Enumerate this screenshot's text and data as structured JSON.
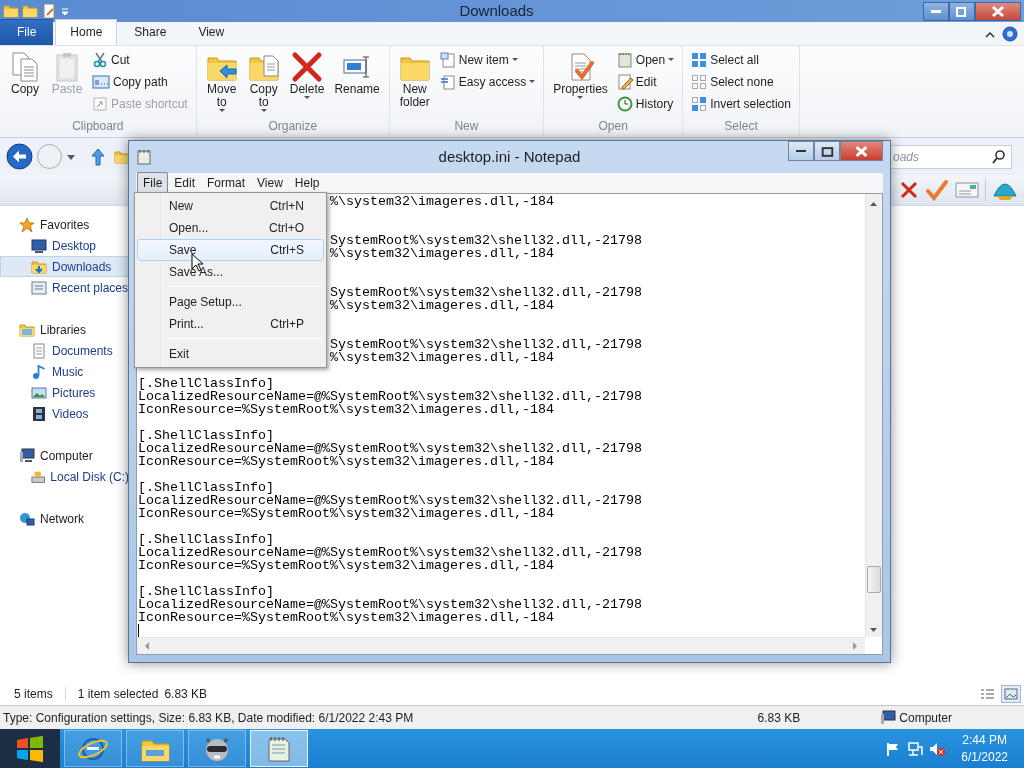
{
  "explorer": {
    "title": "Downloads",
    "ribbon_tabs": [
      {
        "label": "File",
        "kind": "file",
        "selected": false
      },
      {
        "label": "Home",
        "kind": "tab",
        "selected": true
      },
      {
        "label": "Share",
        "kind": "tab",
        "selected": false
      },
      {
        "label": "View",
        "kind": "tab",
        "selected": false
      }
    ],
    "ribbon_groups": [
      {
        "label": "Clipboard",
        "items": [
          {
            "label": "Copy",
            "kind": "large",
            "disabled": false,
            "dropdown": false
          },
          {
            "label": "Paste",
            "kind": "large",
            "disabled": true,
            "dropdown": false
          },
          {
            "label": "Cut",
            "kind": "small",
            "disabled": false,
            "dropdown": false
          },
          {
            "label": "Copy path",
            "kind": "small",
            "disabled": false,
            "dropdown": false
          },
          {
            "label": "Paste shortcut",
            "kind": "small",
            "disabled": true,
            "dropdown": false
          }
        ]
      },
      {
        "label": "Organize",
        "items": [
          {
            "label": "Move to",
            "kind": "large",
            "disabled": false,
            "dropdown": true
          },
          {
            "label": "Copy to",
            "kind": "large",
            "disabled": false,
            "dropdown": true
          },
          {
            "label": "Delete",
            "kind": "large",
            "disabled": false,
            "dropdown": true
          },
          {
            "label": "Rename",
            "kind": "large",
            "disabled": false,
            "dropdown": false
          }
        ]
      },
      {
        "label": "New",
        "items": [
          {
            "label": "New folder",
            "kind": "large",
            "disabled": false,
            "dropdown": false
          },
          {
            "label": "New item",
            "kind": "small",
            "disabled": false,
            "dropdown": true
          },
          {
            "label": "Easy access",
            "kind": "small",
            "disabled": false,
            "dropdown": true
          }
        ]
      },
      {
        "label": "Open",
        "items": [
          {
            "label": "Properties",
            "kind": "large",
            "disabled": false,
            "dropdown": true
          },
          {
            "label": "Open",
            "kind": "small",
            "disabled": false,
            "dropdown": true
          },
          {
            "label": "Edit",
            "kind": "small",
            "disabled": false,
            "dropdown": false
          },
          {
            "label": "History",
            "kind": "small",
            "disabled": false,
            "dropdown": false
          }
        ]
      },
      {
        "label": "Select",
        "items": [
          {
            "label": "Select all",
            "kind": "small",
            "disabled": false,
            "dropdown": false
          },
          {
            "label": "Select none",
            "kind": "small",
            "disabled": false,
            "dropdown": false
          },
          {
            "label": "Invert selection",
            "kind": "small",
            "disabled": false,
            "dropdown": false
          }
        ]
      }
    ],
    "search": {
      "placeholder": "oads"
    },
    "navigation": [
      {
        "label": "Favorites",
        "selected": false,
        "children": [
          {
            "label": "Desktop",
            "selected": false
          },
          {
            "label": "Downloads",
            "selected": true
          },
          {
            "label": "Recent places",
            "selected": false
          }
        ]
      },
      {
        "label": "Libraries",
        "selected": false,
        "children": [
          {
            "label": "Documents",
            "selected": false
          },
          {
            "label": "Music",
            "selected": false
          },
          {
            "label": "Pictures",
            "selected": false
          },
          {
            "label": "Videos",
            "selected": false
          }
        ]
      },
      {
        "label": "Computer",
        "selected": false,
        "children": [
          {
            "label": "Local Disk (C:)",
            "selected": false
          }
        ]
      },
      {
        "label": "Network",
        "selected": false
      }
    ],
    "status": {
      "item_count": "5 items",
      "selection": "1 item selected",
      "selection_size": "6.83 KB"
    },
    "view_buttons": [
      {
        "kind": "details",
        "selected": false
      },
      {
        "kind": "large_icons",
        "selected": true
      }
    ],
    "details_bar": {
      "description": "Type: Configuration settings, Size: 6.83 KB, Date modified: 6/1/2022 2:43 PM",
      "size": "6.83 KB",
      "location": "Computer"
    }
  },
  "notepad": {
    "title": "desktop.ini - Notepad",
    "menu": [
      {
        "label": "File",
        "selected": true
      },
      {
        "label": "Edit",
        "selected": false
      },
      {
        "label": "Format",
        "selected": false
      },
      {
        "label": "View",
        "selected": false
      },
      {
        "label": "Help",
        "selected": false
      }
    ],
    "file_menu": [
      {
        "kind": "item",
        "label": "New",
        "shortcut": "Ctrl+N",
        "selected": false
      },
      {
        "kind": "item",
        "label": "Open...",
        "shortcut": "Ctrl+O",
        "selected": false
      },
      {
        "kind": "item",
        "label": "Save",
        "shortcut": "Ctrl+S",
        "selected": true
      },
      {
        "kind": "item",
        "label": "Save As...",
        "selected": false
      },
      {
        "kind": "separator"
      },
      {
        "kind": "item",
        "label": "Page Setup...",
        "selected": false
      },
      {
        "kind": "item",
        "label": "Print...",
        "shortcut": "Ctrl+P",
        "selected": false
      },
      {
        "kind": "separator"
      },
      {
        "kind": "item",
        "label": "Exit",
        "selected": false
      }
    ],
    "lines": [
      {
        "kind": "partial",
        "text": "%\\system32\\imageres.dll,-184"
      },
      {
        "kind": "gap"
      },
      {
        "kind": "gap"
      },
      {
        "kind": "partial",
        "text": "SystemRoot%\\system32\\shell32.dll,-21798"
      },
      {
        "kind": "partial",
        "text": "%\\system32\\imageres.dll,-184"
      },
      {
        "kind": "gap"
      },
      {
        "kind": "gap"
      },
      {
        "kind": "partial",
        "text": "SystemRoot%\\system32\\shell32.dll,-21798"
      },
      {
        "kind": "partial",
        "text": "%\\system32\\imageres.dll,-184"
      },
      {
        "kind": "gap"
      },
      {
        "kind": "gap"
      },
      {
        "kind": "partial",
        "text": "SystemRoot%\\system32\\shell32.dll,-21798"
      },
      {
        "kind": "partial",
        "text": "%\\system32\\imageres.dll,-184"
      },
      {
        "kind": "gap"
      },
      {
        "kind": "full",
        "text": "[.ShellClassInfo]"
      },
      {
        "kind": "full",
        "text": "LocalizedResourceName=@%SystemRoot%\\system32\\shell32.dll,-21798"
      },
      {
        "kind": "full",
        "text": "IconResource=%SystemRoot%\\system32\\imageres.dll,-184"
      },
      {
        "kind": "gap"
      },
      {
        "kind": "full",
        "text": "[.ShellClassInfo]"
      },
      {
        "kind": "full",
        "text": "LocalizedResourceName=@%SystemRoot%\\system32\\shell32.dll,-21798"
      },
      {
        "kind": "full",
        "text": "IconResource=%SystemRoot%\\system32\\imageres.dll,-184"
      },
      {
        "kind": "gap"
      },
      {
        "kind": "full",
        "text": "[.ShellClassInfo]"
      },
      {
        "kind": "full",
        "text": "LocalizedResourceName=@%SystemRoot%\\system32\\shell32.dll,-21798"
      },
      {
        "kind": "full",
        "text": "IconResource=%SystemRoot%\\system32\\imageres.dll,-184"
      },
      {
        "kind": "gap"
      },
      {
        "kind": "full",
        "text": "[.ShellClassInfo]"
      },
      {
        "kind": "full",
        "text": "LocalizedResourceName=@%SystemRoot%\\system32\\shell32.dll,-21798"
      },
      {
        "kind": "full",
        "text": "IconResource=%SystemRoot%\\system32\\imageres.dll,-184"
      },
      {
        "kind": "gap"
      },
      {
        "kind": "full",
        "text": "[.ShellClassInfo]"
      },
      {
        "kind": "full",
        "text": "LocalizedResourceName=@%SystemRoot%\\system32\\shell32.dll,-21798"
      },
      {
        "kind": "full",
        "text": "IconResource=%SystemRoot%\\system32\\imageres.dll,-184"
      },
      {
        "kind": "caret"
      }
    ]
  },
  "taskbar": {
    "apps": [
      {
        "kind": "browser",
        "selected": false
      },
      {
        "kind": "explorer",
        "selected": false
      },
      {
        "kind": "raccoon",
        "selected": false
      },
      {
        "kind": "notepad",
        "selected": true
      }
    ],
    "time": "2:44 PM",
    "date": "6/1/2022"
  }
}
